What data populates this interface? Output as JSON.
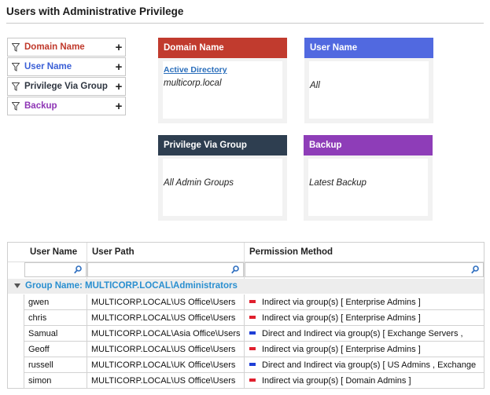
{
  "title": "Users with Administrative Privilege",
  "filters": [
    {
      "label": "Domain Name",
      "color": "#c0392b"
    },
    {
      "label": "User Name",
      "color": "#3a5fd6"
    },
    {
      "label": "Privilege Via Group",
      "color": "#2e3540"
    },
    {
      "label": "Backup",
      "color": "#8e35b5"
    }
  ],
  "cards": [
    {
      "title": "Domain Name",
      "color": "#c13b2e",
      "link": "Active Directory",
      "value": "multicorp.local"
    },
    {
      "title": "User Name",
      "color": "#5169e0",
      "link": "",
      "value": "All"
    },
    {
      "title": "Privilege Via Group",
      "color": "#2e3e50",
      "link": "",
      "value": "All Admin Groups"
    },
    {
      "title": "Backup",
      "color": "#8e3db8",
      "link": "",
      "value": "Latest Backup"
    }
  ],
  "grid": {
    "columns": [
      "User Name",
      "User Path",
      "Permission Method"
    ],
    "group_label": "Group Name: MULTICORP.LOCAL\\Administrators",
    "rows": [
      {
        "user": "gwen",
        "path": "MULTICORP.LOCAL\\US Office\\Users",
        "method": "Indirect via group(s) [ Enterprise Admins  ]",
        "mark": "#e0202e"
      },
      {
        "user": "chris",
        "path": "MULTICORP.LOCAL\\US Office\\Users",
        "method": "Indirect via group(s) [ Enterprise Admins  ]",
        "mark": "#e0202e"
      },
      {
        "user": "Samual",
        "path": "MULTICORP.LOCAL\\Asia Office\\Users",
        "method": "Direct and Indirect via group(s) [ Exchange  Servers  ,",
        "mark": "#1f3fd6"
      },
      {
        "user": "Geoff",
        "path": "MULTICORP.LOCAL\\US Office\\Users",
        "method": "Indirect via group(s) [ Enterprise Admins  ]",
        "mark": "#e0202e"
      },
      {
        "user": "russell",
        "path": "MULTICORP.LOCAL\\UK Office\\Users",
        "method": "Direct and Indirect via group(s) [ US Admins  , Exchange",
        "mark": "#1f3fd6"
      },
      {
        "user": "simon",
        "path": "MULTICORP.LOCAL\\US Office\\Users",
        "method": "Indirect via group(s) [ Domain Admins  ]",
        "mark": "#e0202e"
      }
    ]
  }
}
